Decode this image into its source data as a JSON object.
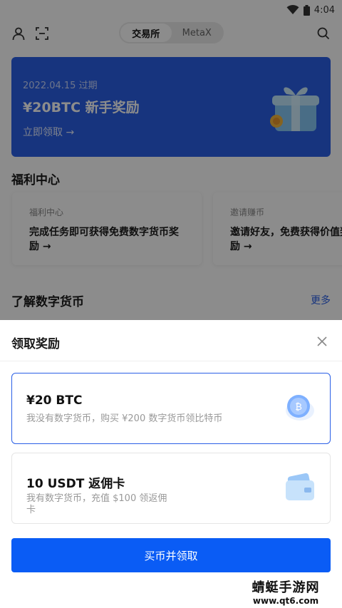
{
  "status_bar": {
    "time": "4:04"
  },
  "top_nav": {
    "tabs": [
      {
        "label": "交易所",
        "active": true
      },
      {
        "label": "MetaX",
        "active": false
      }
    ]
  },
  "banner": {
    "date": "2022.04.15 过期",
    "title": "¥20BTC 新手奖励",
    "cta": "立即领取 →"
  },
  "welfare": {
    "title": "福利中心",
    "cards": [
      {
        "category": "福利中心",
        "desc": "完成任务即可获得免费数字货币奖励 →"
      },
      {
        "category": "邀请赚币",
        "desc": "邀请好友，免费获得价值奖励 →"
      }
    ]
  },
  "learn": {
    "title": "了解数字货币",
    "more": "更多"
  },
  "sheet": {
    "title": "领取奖励",
    "options": [
      {
        "title": "¥20 BTC",
        "desc": "我没有数字货币，购买 ¥200 数字货币领比特币",
        "selected": true
      },
      {
        "title": "10 USDT 返佣卡",
        "desc": "我有数字货币，充值 $100 领返佣卡",
        "selected": false
      }
    ],
    "button": "买币并领取"
  },
  "watermark": {
    "line1": "蜻蜓手游网",
    "line2": "www.qt6.com"
  },
  "colors": {
    "accent": "#0a5cf5",
    "banner": "#2a5fe6",
    "overlay": "rgba(0,0,0,0.45)"
  }
}
